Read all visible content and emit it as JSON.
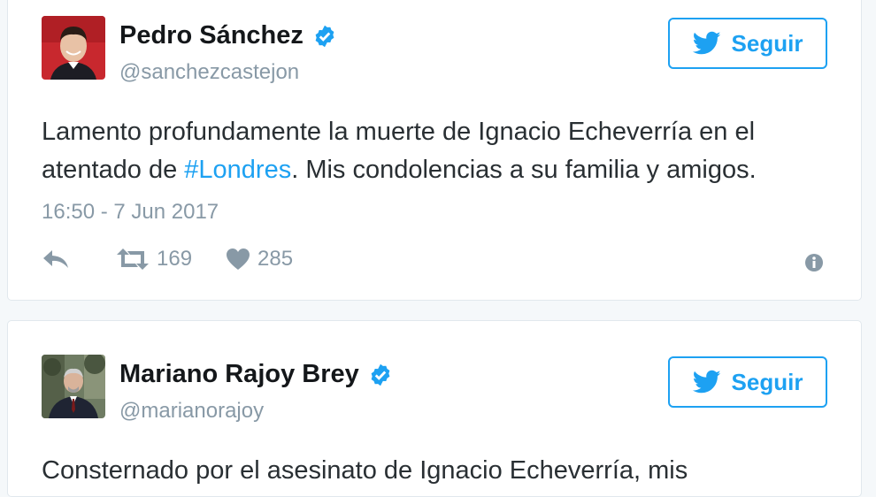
{
  "tweets": [
    {
      "name": "Pedro Sánchez",
      "handle": "@sanchezcastejon",
      "follow_label": "Seguir",
      "text_before": "Lamento profundamente la muerte de Ignacio Echeverría en el atentado de ",
      "hashtag": "#Londres",
      "text_after": ". Mis condolencias a su familia y amigos.",
      "date": "16:50 - 7 Jun 2017",
      "retweets": "169",
      "likes": "285"
    },
    {
      "name": "Mariano Rajoy Brey",
      "handle": "@marianorajoy",
      "follow_label": "Seguir",
      "text": "Consternado por el asesinato de Ignacio Echeverría, mis"
    }
  ],
  "colors": {
    "accent": "#1da1f2",
    "muted": "#8899a6",
    "avatar1_bg": "#c8282e"
  },
  "icons": [
    "verified-icon",
    "twitter-bird-icon",
    "reply-icon",
    "retweet-icon",
    "heart-icon",
    "info-icon"
  ]
}
